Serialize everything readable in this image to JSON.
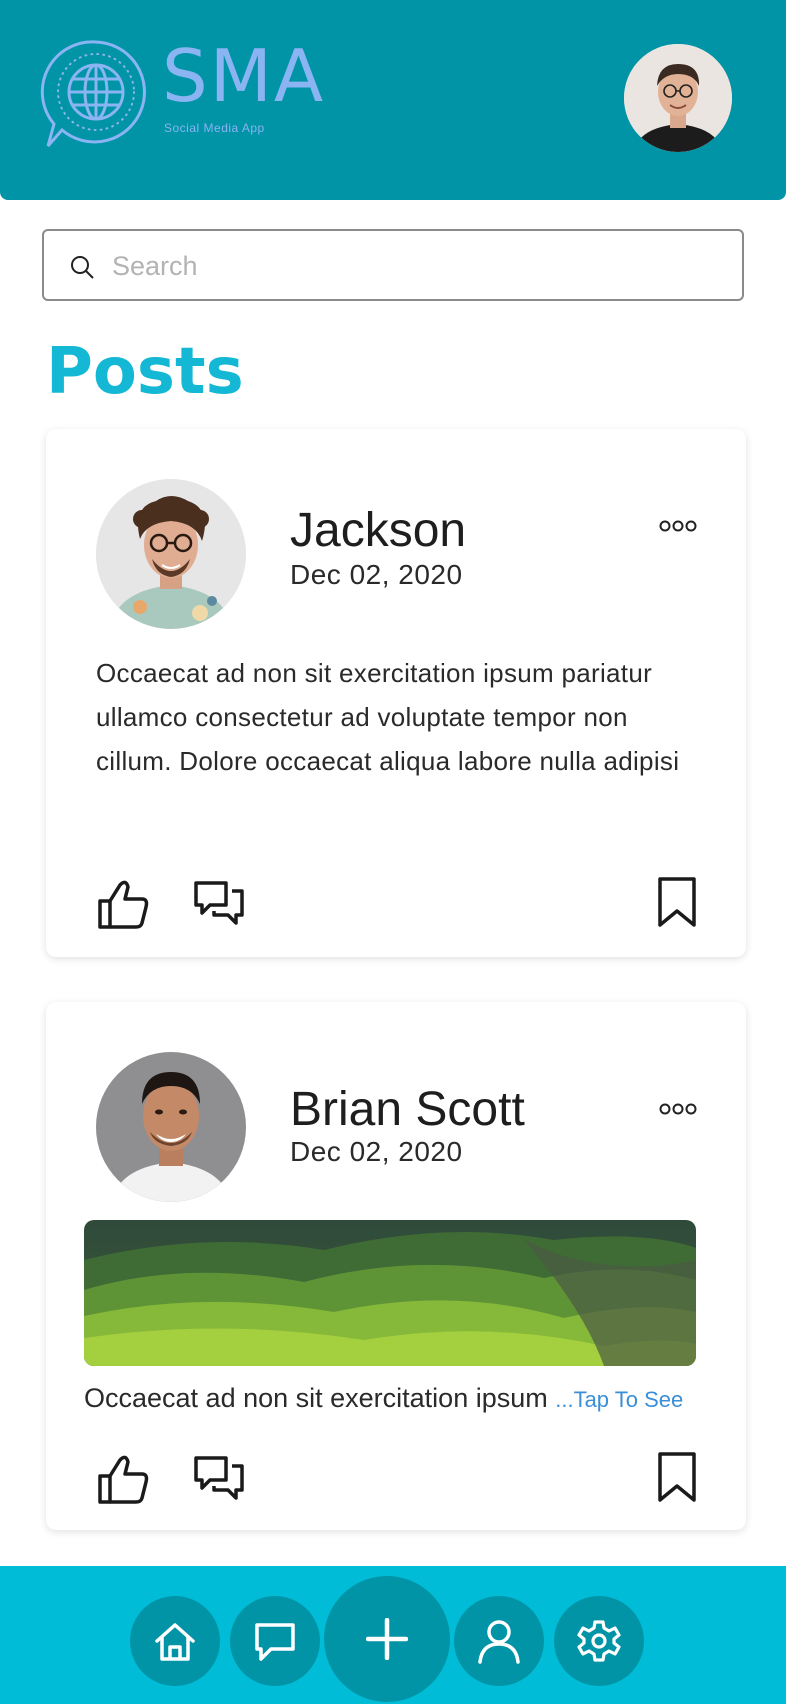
{
  "app": {
    "logo_title": "SMA",
    "logo_subtitle": "Social Media App"
  },
  "search": {
    "placeholder": "Search",
    "value": ""
  },
  "section_title": "Posts",
  "posts": [
    {
      "author": "Jackson",
      "date": "Dec 02, 2020",
      "text": "Occaecat ad non sit exercitation ipsum pariatur ullamco consectetur ad voluptate tempor non cillum. Dolore occaecat aliqua labore nulla adipisi"
    },
    {
      "author": "Brian Scott",
      "date": "Dec 02, 2020",
      "text": "Occaecat ad non sit exercitation ipsum ",
      "more_link": "...Tap To See"
    }
  ],
  "icons": {
    "header": [
      "globe-chat-icon",
      "avatar"
    ],
    "search": "search-icon",
    "post_menu": "more-dots-icon",
    "post_actions": [
      "thumbs-up-icon",
      "chat-bubbles-icon",
      "bookmark-icon"
    ],
    "nav": [
      "home-icon",
      "chat-icon",
      "plus-icon",
      "user-icon",
      "gear-icon"
    ]
  },
  "colors": {
    "header": "#0094a6",
    "nav_bar": "#00bcd6",
    "nav_button": "#0094a6",
    "logo": "#8ab4f2",
    "title": "#14b8d4",
    "link": "#3a8fd6"
  }
}
